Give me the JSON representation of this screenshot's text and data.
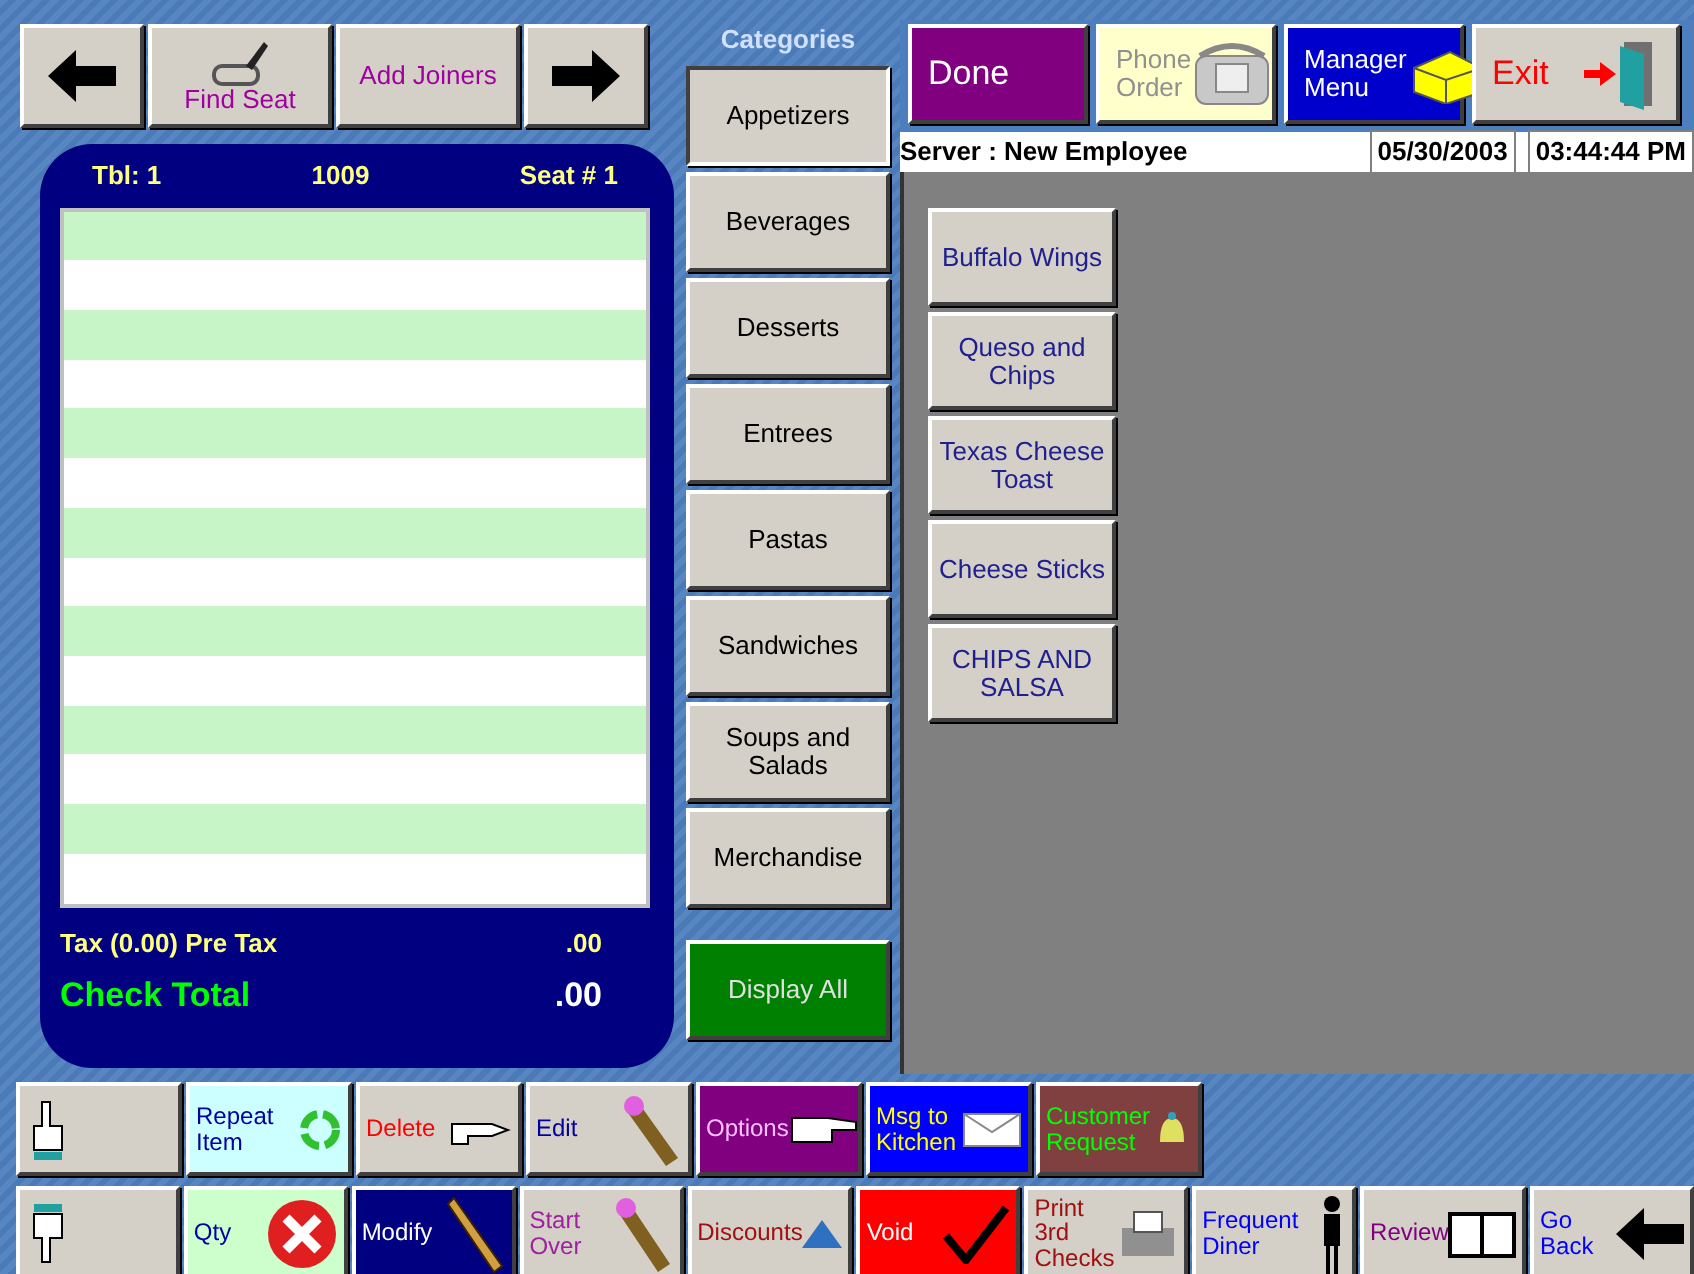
{
  "seat_bar": [
    {
      "kind": "back"
    },
    {
      "kind": "seat",
      "label": "Find Seat"
    },
    {
      "kind": "joiners",
      "label": "Add Joiners"
    },
    {
      "kind": "forward"
    }
  ],
  "check": {
    "table": "Tbl: 1",
    "number": "1009",
    "seat": "Seat # 1",
    "tax_label": "Tax (0.00)  Pre Tax",
    "tax_value": ".00",
    "total_label": "Check Total",
    "total_value": ".00"
  },
  "categories": {
    "title": "Categories",
    "items": [
      {
        "label": "Appetizers",
        "selected": true
      },
      {
        "label": "Beverages",
        "selected": false
      },
      {
        "label": "Desserts",
        "selected": false
      },
      {
        "label": "Entrees",
        "selected": false
      },
      {
        "label": "Pastas",
        "selected": false
      },
      {
        "label": "Sandwiches",
        "selected": false
      },
      {
        "label": "Soups and Salads",
        "selected": false
      },
      {
        "label": "Merchandise",
        "selected": false
      }
    ],
    "display_all": "Display All"
  },
  "top_buttons": [
    {
      "kind": "done",
      "label": "Done",
      "color": "#800080",
      "disabled": false
    },
    {
      "kind": "phone",
      "label": "Phone Order",
      "color": "#ffffcc",
      "disabled": true
    },
    {
      "kind": "manager",
      "label": "Manager Menu",
      "color": "#0000cc",
      "disabled": false
    },
    {
      "kind": "exit",
      "label": "Exit",
      "color": "#d4d0c8",
      "disabled": false
    }
  ],
  "status": {
    "server": "Server : New Employee",
    "date": "05/30/2003",
    "time": "03:44:44 PM"
  },
  "menu_items": [
    "Buffalo Wings",
    "Queso and Chips",
    "Texas Cheese Toast",
    "Cheese Sticks",
    "CHIPS AND SALSA"
  ],
  "bottom_row_1": [
    {
      "kind": "up",
      "color": "#d4d0c8"
    },
    {
      "kind": "repeat",
      "label": "Repeat Item",
      "color": "#ccffff"
    },
    {
      "kind": "delete",
      "label": "Delete",
      "color": "#d4d0c8"
    },
    {
      "kind": "edit",
      "label": "Edit",
      "color": "#d4d0c8"
    },
    {
      "kind": "options",
      "label": "Options",
      "color": "#800080"
    },
    {
      "kind": "message",
      "label": "Msg to Kitchen",
      "color": "#0000ff"
    },
    {
      "kind": "request",
      "label": "Customer Request",
      "color": "#804040"
    }
  ],
  "bottom_row_2": [
    {
      "kind": "down",
      "color": "#d4d0c8"
    },
    {
      "kind": "quantity",
      "label": "Qty",
      "color": "#ccffcc"
    },
    {
      "kind": "modify",
      "label": "Modify",
      "color": "#000080"
    },
    {
      "kind": "restart",
      "label": "Start Over",
      "color": "#d4d0c8"
    },
    {
      "kind": "discounts",
      "label": "Discounts",
      "color": "#d4d0c8"
    },
    {
      "kind": "void",
      "label": "Void",
      "color": "#ff0000"
    },
    {
      "kind": "print",
      "label": "Print 3rd Checks",
      "color": "#d4d0c8"
    },
    {
      "kind": "frequent",
      "label": "Frequent Diner",
      "color": "#d4d0c8"
    },
    {
      "kind": "review",
      "label": "Review",
      "color": "#d4d0c8"
    },
    {
      "kind": "back",
      "label": "Go Back",
      "color": "#d4d0c8"
    }
  ]
}
